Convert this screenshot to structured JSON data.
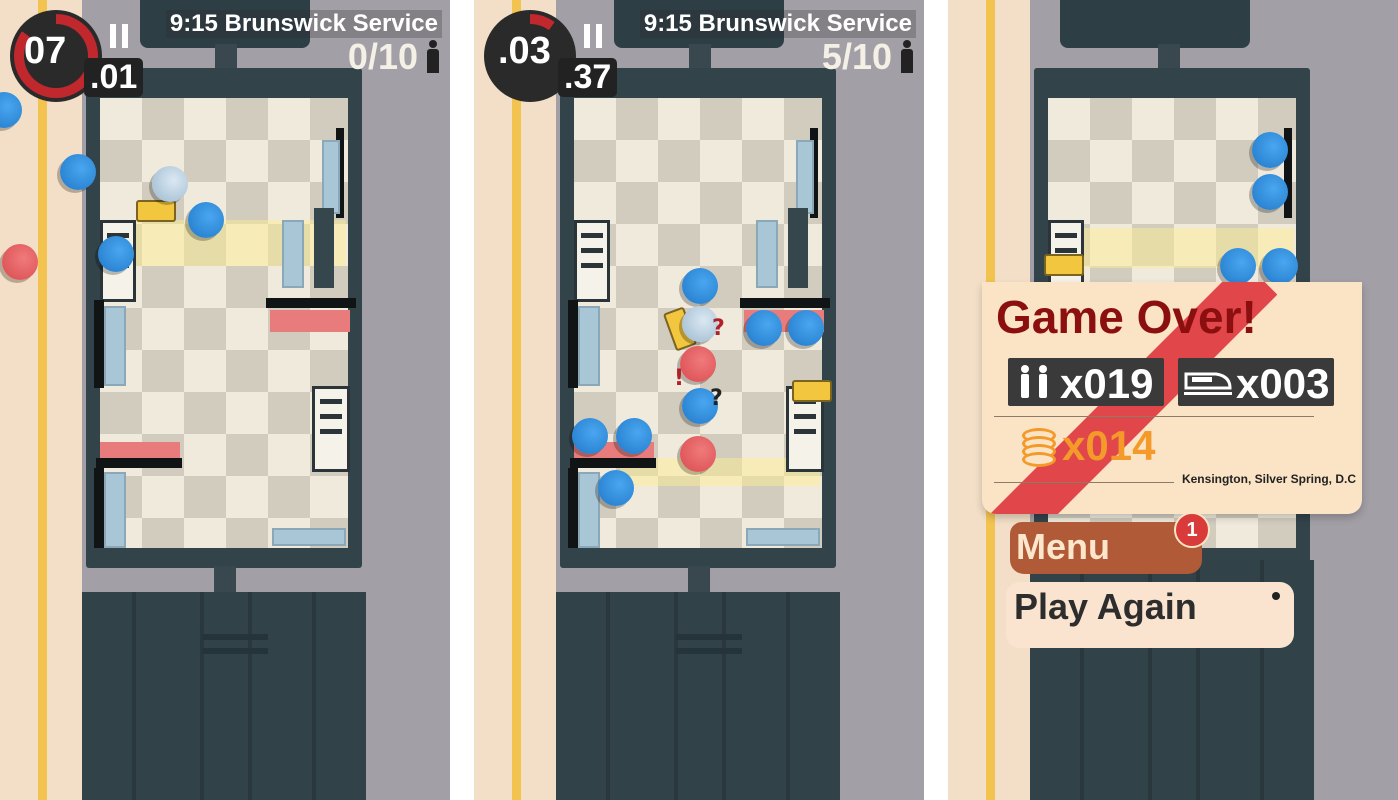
{
  "screens": [
    {
      "timer": {
        "seconds": "07",
        "fraction": ".01",
        "remaining_fraction": 0.85
      },
      "service": "9:15 Brunswick Service",
      "boarded": "0/10"
    },
    {
      "timer": {
        "seconds": ".03",
        "fraction": ".37",
        "remaining_fraction": 0.1
      },
      "service": "9:15 Brunswick Service",
      "boarded": "5/10"
    }
  ],
  "game_over": {
    "title": "Game Over!",
    "passengers": "x019",
    "trains": "x003",
    "coins": "x014",
    "location": "Kensington, Silver Spring, D.C",
    "menu_label": "Menu",
    "menu_badge": "1",
    "play_again_label": "Play Again"
  },
  "colors": {
    "background": "#a29fa6",
    "platform": "#f3dfc7",
    "platform_line": "#f2c34f",
    "train": "#33434a",
    "passenger_blue": "#2f8de0",
    "passenger_red": "#d84a4f",
    "timer_ring": "#c0282e",
    "game_over_title": "#8b0f0f",
    "coin": "#f39a2a"
  },
  "icons": [
    "pause-icon",
    "person-icon",
    "couple-icon",
    "train-icon",
    "coins-icon"
  ]
}
